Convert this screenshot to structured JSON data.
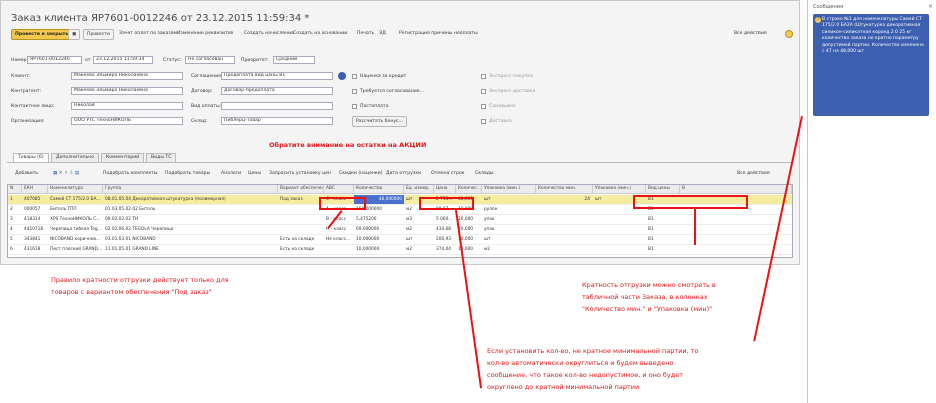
{
  "window": {
    "title": "Заказ клиента ЯР7601-0012246 от 23.12.2015 11:59:34 *"
  },
  "toolbar": {
    "post_close": "Провести и закрыть",
    "post": "Провести",
    "payment": "Зачет оплат по заказам",
    "change_props": "Изменение реквизитов",
    "create_accrual": "Создать начисление",
    "create_based_on": "Создать на основании",
    "print": "Печать",
    "edi": "ЭД",
    "register_reasons": "Регистрация причины неоплаты",
    "all_actions": "Все действия"
  },
  "form": {
    "number_label": "Номер:",
    "number_value": "ЯР7601-0012246",
    "from_label": "от",
    "from_value": "23.12.2015 11:59:34",
    "status_label": "Статус:",
    "status_value": "Не согласован",
    "priority_label": "Приоритет:",
    "priority_value": "Средний",
    "client_label": "Клиент:",
    "client_value": "Макеева Эльмира Николаевна",
    "agreement_label": "Соглашение:",
    "agreement_value": "Предоплата вид цены В1",
    "credit_label": "Наценка за кредит",
    "express_label": "Экспресс-покупка",
    "counterparty_label": "Контрагент:",
    "counterparty_value": "Макеева Эльмира Николаевна",
    "contract_label": "Договор:",
    "contract_value": "Договор-предоплата",
    "approval_label": "Требуется согласование...",
    "express_delivery_label": "Экспресс-доставка",
    "contact_label": "Контактное лицо:",
    "contact_value": "Николай",
    "payment_type_label": "Вид оплаты:",
    "payment_type_value": "",
    "regular_label": "Постоплата",
    "pickup_label": "Самовывоз",
    "org_label": "Организация:",
    "org_value": "ООО УТС ТехноНИКОЛЬ",
    "warehouse_label": "Склад:",
    "warehouse_value": "Пиблерц-Товар",
    "calc_button": "Рассчитать бонус...",
    "delivery_label": "Доставка"
  },
  "warning": "Обратите внимание на остатки на АКЦИИ",
  "tabs": [
    "Товары (6)",
    "Дополнительно",
    "Комментарий",
    "Виды ТС"
  ],
  "grid_toolbar": {
    "add": "Добавить",
    "select_components": "Подобрать комплекты",
    "select_goods": "Подобрать товары",
    "analogs": "Аналоги",
    "prices": "Цены",
    "request_price": "Запросить установку цен",
    "discounts": "Скидки (наценки)",
    "shipment_date": "Дата отгрузки",
    "cancel_rows": "Отмена строк",
    "warehouses": "Склады",
    "all_actions": "Все действия"
  },
  "table": {
    "columns": [
      "N",
      "ЕКН",
      "Номенклатура",
      "Группа",
      "Вариант обеспечен...",
      "АВС",
      "Количество",
      "Ед. измер.",
      "Цена",
      "Количес...",
      "Упаковка (мин.)",
      "Количество мин.",
      "Упаковка (мин.)",
      "Вид цены",
      "В"
    ],
    "rows": [
      [
        "1",
        "407085",
        "Самей СТ 175/2.0 БА...",
        "08.01.05.04 Декоративная штукатурка (полимерная)",
        "Под заказ",
        "С - класс",
        "48,000000",
        "шт",
        "2 715...",
        "48,000",
        "шт",
        "24",
        "шт",
        "В1",
        ""
      ],
      [
        "2",
        "000057",
        "Битоль ТПП",
        "01.03.05.02.02 Битоль",
        "",
        "А - класс",
        "150,000000",
        "м2",
        "88,87",
        "10,000",
        "рулон",
        "",
        "",
        "В1",
        ""
      ],
      [
        "3",
        "418314",
        "XPS ТехноНИКОЛЬ С...",
        "09.02.02.02 ТН",
        "",
        "В - класс",
        "5,475200",
        "м3",
        "5 060...",
        "20,000",
        "упак",
        "",
        "",
        "В1",
        ""
      ],
      [
        "4",
        "4410718",
        "Черепица гибкая Teg...",
        "02.02.06.02 TEGOLA Черепица",
        "",
        "Н - класс",
        "69,000000",
        "м2",
        "434,68",
        "20,000",
        "упак",
        "",
        "",
        "В1",
        ""
      ],
      [
        "5",
        "343841",
        "NICOBAND коричнев...",
        "03.01.03.01 NICOBAND",
        "Есть на складе",
        "Не класс...",
        "10,000000",
        "шт",
        "200,93",
        "10,000",
        "шт",
        "",
        "",
        "В1",
        ""
      ],
      [
        "6",
        "431618",
        "Пист плоский GRAND...",
        "11.01.05.01 GRAND LINE",
        "Есть на складе",
        "",
        "10,000000",
        "м2",
        "374,04",
        "10,000",
        "м2",
        "",
        "",
        "В1",
        ""
      ]
    ]
  },
  "annotations": {
    "left_note": [
      "Правило кратности отгрузки действует только для",
      "товаров с вариантом обеспечения \"Под заказ\""
    ],
    "right_note": [
      "Кратность отгрузки можно смотреть в",
      "табличной части Заказа, в колонках",
      "\"Количество мин.\" и \"Упаковка (мин)\""
    ],
    "bottom_note": [
      "Если установить кол-во, не кратное минимальной партии, то",
      "кол-во автоматически округлиться и будем выведено",
      "сообщение, что такое кол-во недопустимое, и оно будет",
      "округлено до кратной минимальной партии"
    ]
  },
  "messages_panel": {
    "title": "Сообщения",
    "close": "×",
    "text": "В строке №1 для номенклатуры Самей СТ 175/2.0 БА2А (Штукатурка декоративная силикон-силикатная короед 2.0 25 кг количество заказа не кратно параметру допустимой партии. Количество изменено с 47 на 48,000 шт"
  },
  "colors": {
    "accent_yellow": "#f2c94c",
    "annotation_red": "#e0181d",
    "message_blue": "#3c5fb0",
    "selection_blue": "#4a6fcf"
  }
}
